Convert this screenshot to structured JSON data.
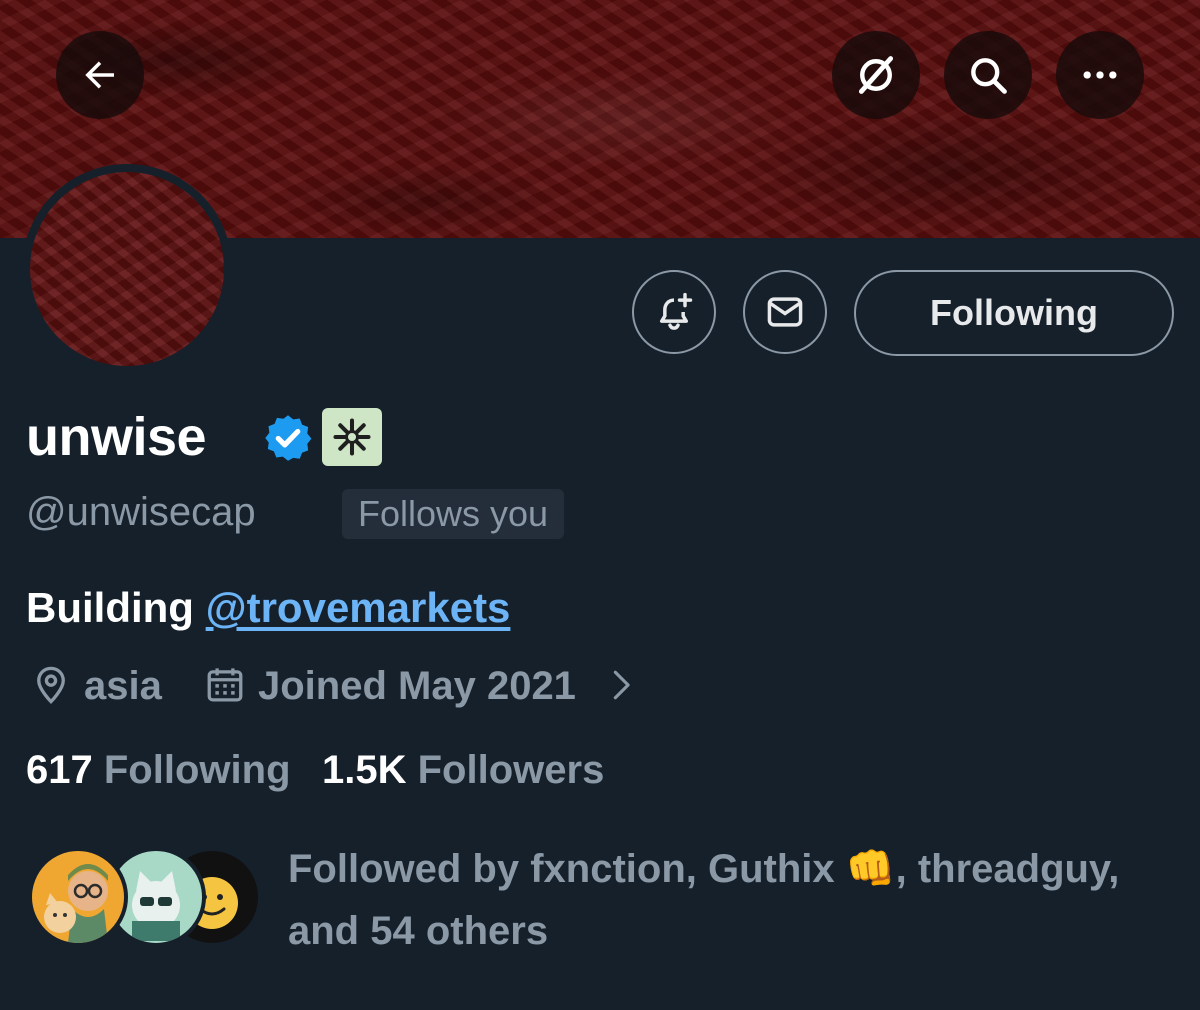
{
  "header": {
    "back_icon": "arrow-left-icon",
    "right_icons": [
      "grok-icon",
      "search-icon",
      "more-icon"
    ]
  },
  "actions": {
    "notify_icon": "bell-plus-icon",
    "message_icon": "envelope-icon",
    "follow_label": "Following"
  },
  "profile": {
    "name": "unwise",
    "handle": "@unwisecap",
    "follows_you": "Follows you",
    "bio_prefix": "Building ",
    "bio_mention": "@trovemarkets",
    "location": "asia",
    "joined": "Joined May 2021",
    "following_count": "617",
    "following_label": "Following",
    "followers_count": "1.5K",
    "followers_label": "Followers",
    "followed_by_prefix": "Followed by fxnction, Guthix ",
    "followed_by_emoji": "👊",
    "followed_by_suffix": ", threadguy, and 54 others"
  },
  "colors": {
    "background": "#15202b",
    "banner": "#5c0d0d",
    "link": "#6cb4f5",
    "verified": "#1d9bf0",
    "secondary_text": "#8b98a5"
  }
}
